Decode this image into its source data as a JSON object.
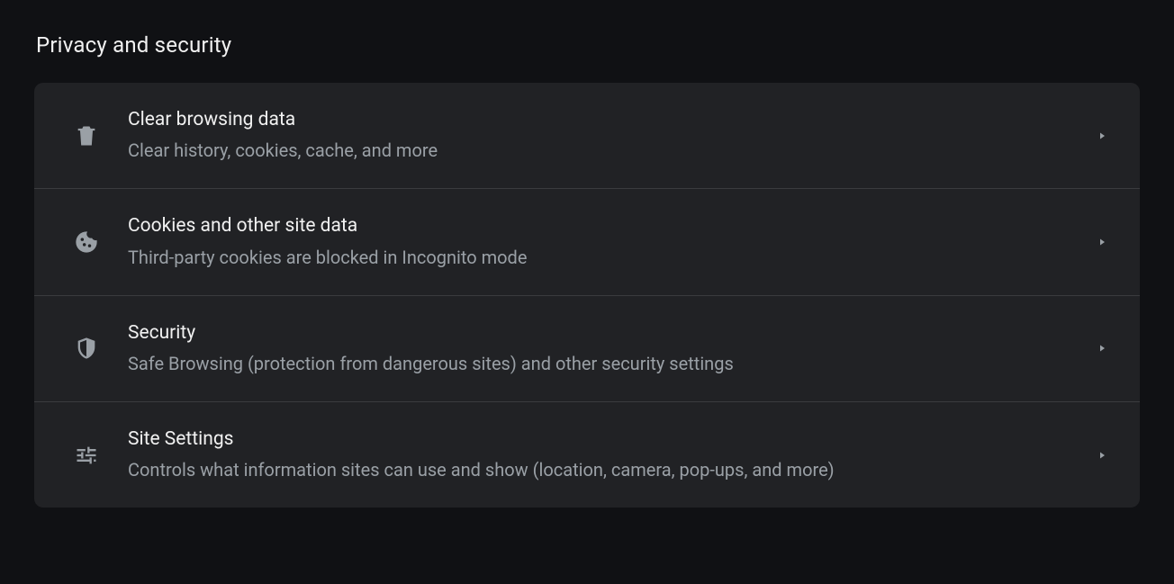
{
  "section": {
    "title": "Privacy and security",
    "items": [
      {
        "icon": "trash-icon",
        "title": "Clear browsing data",
        "subtitle": "Clear history, cookies, cache, and more"
      },
      {
        "icon": "cookie-icon",
        "title": "Cookies and other site data",
        "subtitle": "Third-party cookies are blocked in Incognito mode"
      },
      {
        "icon": "shield-icon",
        "title": "Security",
        "subtitle": "Safe Browsing (protection from dangerous sites) and other security settings"
      },
      {
        "icon": "sliders-icon",
        "title": "Site Settings",
        "subtitle": "Controls what information sites can use and show (location, camera, pop-ups, and more)"
      }
    ]
  }
}
